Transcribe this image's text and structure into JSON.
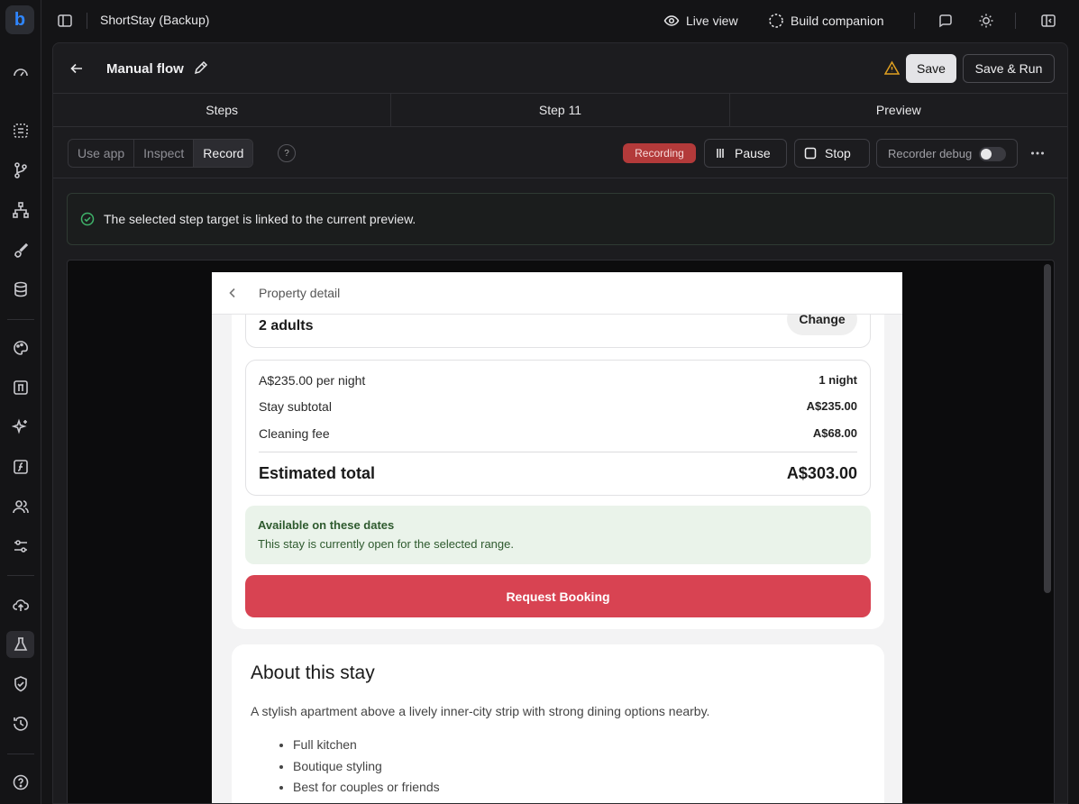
{
  "app": {
    "title": "ShortStay (Backup)"
  },
  "topbar": {
    "live_view": "Live view",
    "build_companion": "Build companion"
  },
  "header": {
    "flow_title": "Manual flow",
    "save": "Save",
    "save_run": "Save & Run"
  },
  "tabs": [
    {
      "label": "Steps"
    },
    {
      "label": "Step 11"
    },
    {
      "label": "Preview"
    }
  ],
  "toolbar": {
    "modes": [
      "Use app",
      "Inspect",
      "Record"
    ],
    "active_mode": "Record",
    "help": "?",
    "recording_badge": "Recording",
    "pause": "Pause",
    "stop": "Stop",
    "recorder_debug": "Recorder debug"
  },
  "notice": {
    "text": "The selected step target is linked to the current preview."
  },
  "preview": {
    "page_title": "Property detail",
    "guests": "2 adults",
    "change": "Change",
    "price_rows": [
      {
        "label": "A$235.00 per night",
        "value": "1 night"
      },
      {
        "label": "Stay subtotal",
        "value": "A$235.00"
      },
      {
        "label": "Cleaning fee",
        "value": "A$68.00"
      }
    ],
    "total_label": "Estimated total",
    "total_value": "A$303.00",
    "availability_title": "Available on these dates",
    "availability_text": "This stay is currently open for the selected range.",
    "book_button": "Request Booking",
    "about_title": "About this stay",
    "about_desc": "A stylish apartment above a lively inner-city strip with strong dining options nearby.",
    "features": [
      "Full kitchen",
      "Boutique styling",
      "Best for couples or friends"
    ]
  },
  "colors": {
    "accent_red": "#d84352",
    "recording": "#b33a3a",
    "success": "#3fb36a",
    "warning": "#e0a020"
  }
}
